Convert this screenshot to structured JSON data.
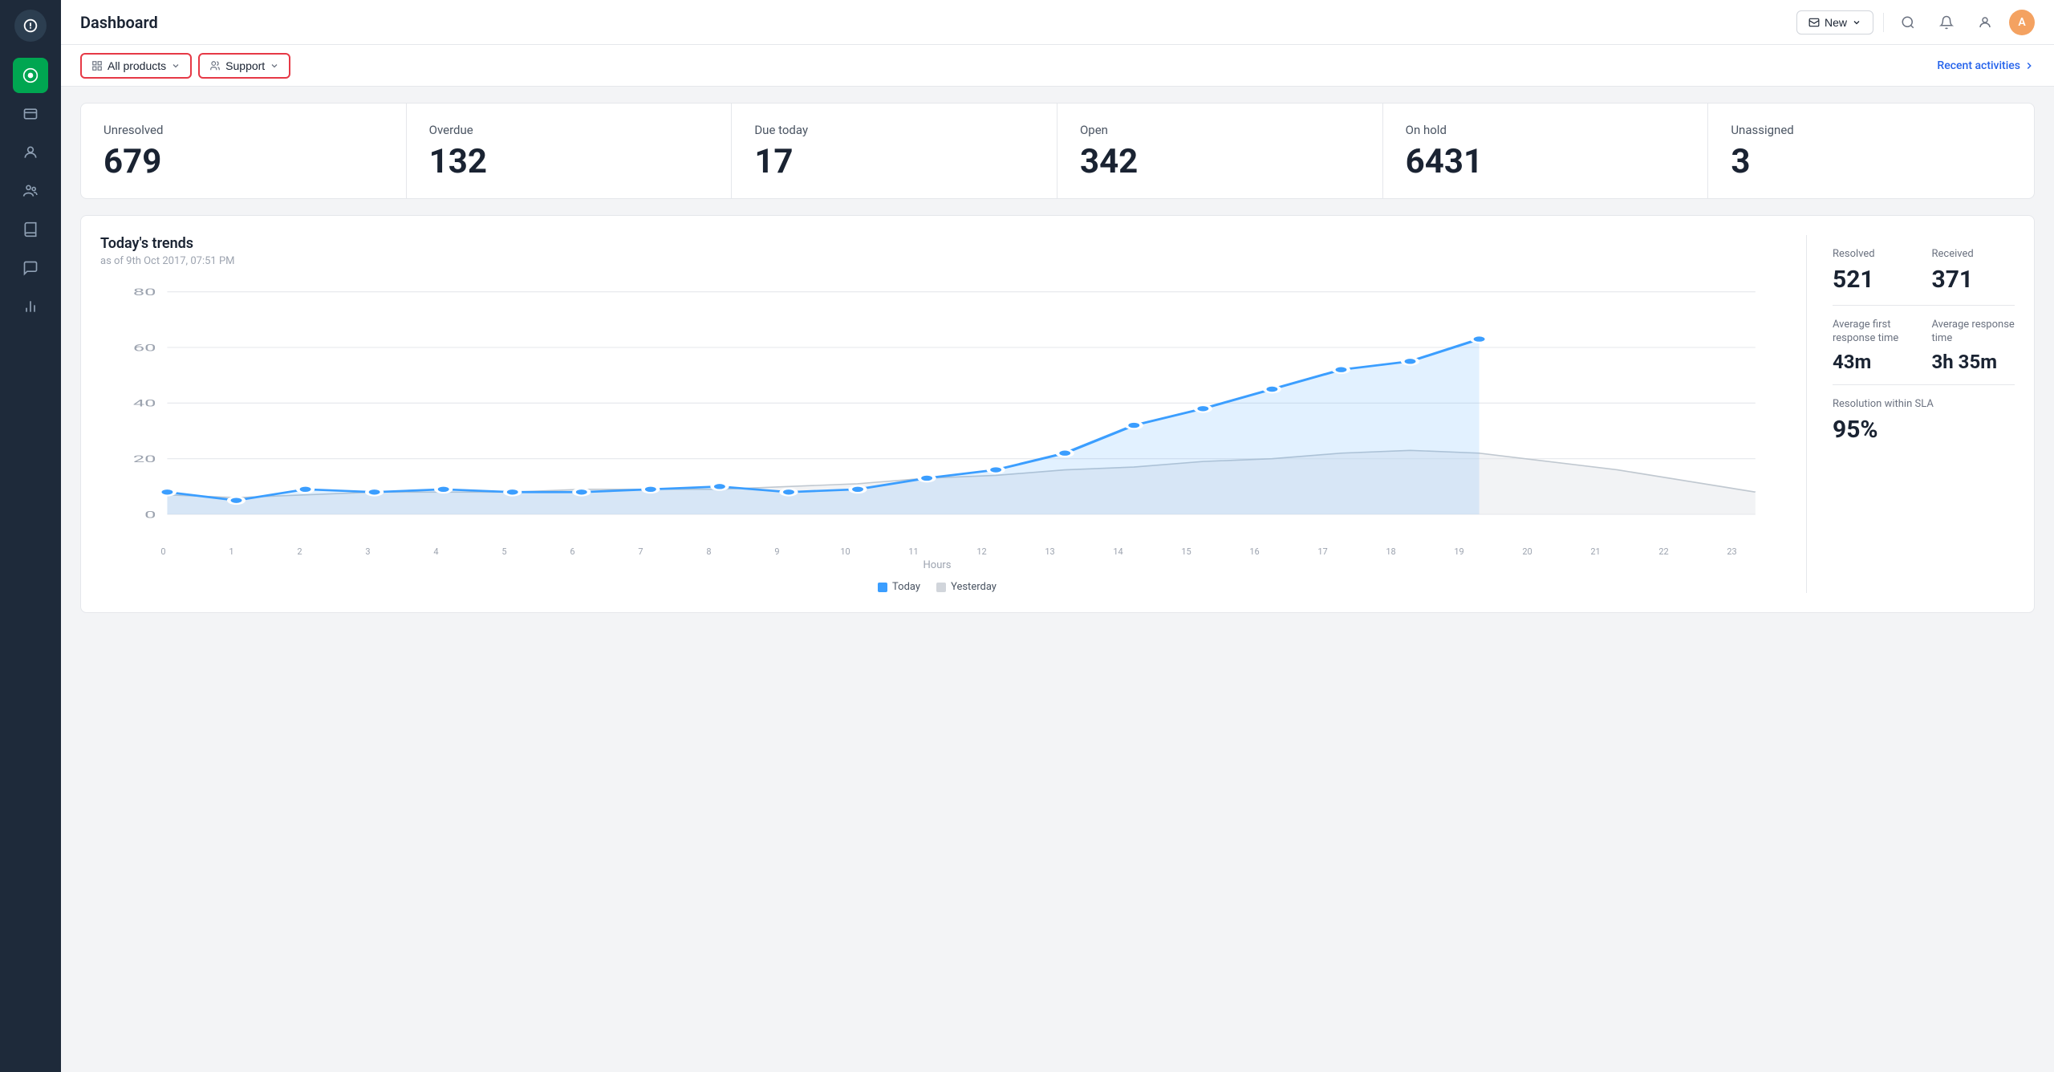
{
  "sidebar": {
    "logo_char": "♪",
    "items": [
      {
        "id": "home",
        "icon": "⊙",
        "active": true
      },
      {
        "id": "tickets",
        "icon": "▭"
      },
      {
        "id": "contacts",
        "icon": "👤"
      },
      {
        "id": "teams",
        "icon": "⚇"
      },
      {
        "id": "books",
        "icon": "📖"
      },
      {
        "id": "chat",
        "icon": "💬"
      },
      {
        "id": "reports",
        "icon": "📊"
      }
    ]
  },
  "header": {
    "title": "Dashboard",
    "new_button": "New",
    "avatar_initials": "A"
  },
  "filter_bar": {
    "all_products_label": "All products",
    "support_label": "Support",
    "recent_activities_label": "Recent activities"
  },
  "stats": [
    {
      "label": "Unresolved",
      "value": "679"
    },
    {
      "label": "Overdue",
      "value": "132"
    },
    {
      "label": "Due today",
      "value": "17"
    },
    {
      "label": "Open",
      "value": "342"
    },
    {
      "label": "On hold",
      "value": "6431"
    },
    {
      "label": "Unassigned",
      "value": "3"
    }
  ],
  "chart": {
    "title": "Today's trends",
    "subtitle": "as of 9th Oct 2017, 07:51 PM",
    "x_labels": [
      "0",
      "1",
      "2",
      "3",
      "4",
      "5",
      "6",
      "7",
      "8",
      "9",
      "10",
      "11",
      "12",
      "13",
      "14",
      "15",
      "16",
      "17",
      "18",
      "19",
      "20",
      "21",
      "22",
      "23"
    ],
    "x_axis_label": "Hours",
    "today_data": [
      8,
      5,
      9,
      8,
      9,
      8,
      8,
      9,
      10,
      8,
      9,
      13,
      16,
      22,
      32,
      38,
      45,
      52,
      55,
      63,
      null,
      null,
      null,
      null
    ],
    "yesterday_data": [
      7,
      6,
      7,
      8,
      8,
      8,
      9,
      9,
      9,
      10,
      11,
      13,
      14,
      16,
      17,
      19,
      20,
      22,
      23,
      22,
      19,
      16,
      12,
      8
    ],
    "y_labels": [
      "0",
      "20",
      "40",
      "60",
      "80"
    ],
    "legend_today": "Today",
    "legend_yesterday": "Yesterday",
    "y_max": 80
  },
  "metrics": [
    {
      "label": "Resolved",
      "value": "521"
    },
    {
      "label": "Received",
      "value": "371"
    },
    {
      "label": "Average first\nresponse time",
      "value": "43m"
    },
    {
      "label": "Average response\ntime",
      "value": "3h 35m"
    },
    {
      "label": "Resolution within\nSLA",
      "value": "95%",
      "span": 2
    }
  ]
}
